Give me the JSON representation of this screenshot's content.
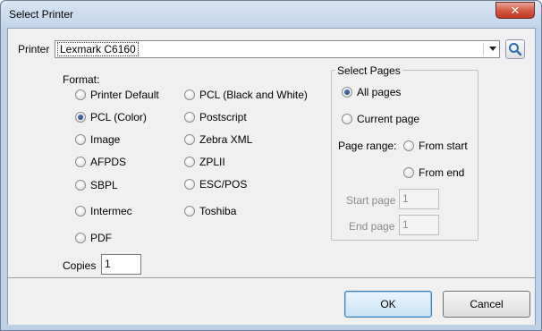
{
  "window": {
    "title": "Select Printer",
    "close_glyph": "✕"
  },
  "printer": {
    "label": "Printer",
    "selected": "Lexmark C6160",
    "search_icon": "search-icon"
  },
  "format": {
    "label": "Format:",
    "options": [
      {
        "label": "Printer Default",
        "checked": false
      },
      {
        "label": "PCL (Color)",
        "checked": true
      },
      {
        "label": "Image",
        "checked": false
      },
      {
        "label": "AFPDS",
        "checked": false
      },
      {
        "label": "SBPL",
        "checked": false
      },
      {
        "label": "Intermec",
        "checked": false
      },
      {
        "label": "PDF",
        "checked": false
      },
      {
        "label": "PCL (Black and White)",
        "checked": false
      },
      {
        "label": "Postscript",
        "checked": false
      },
      {
        "label": "Zebra XML",
        "checked": false
      },
      {
        "label": "ZPLII",
        "checked": false
      },
      {
        "label": "ESC/POS",
        "checked": false
      },
      {
        "label": "Toshiba",
        "checked": false
      }
    ]
  },
  "copies": {
    "label": "Copies",
    "value": "1"
  },
  "pages": {
    "legend": "Select Pages",
    "all_pages": "All pages",
    "current_page": "Current page",
    "range_label": "Page range:",
    "from_start": "From start",
    "from_end": "From end",
    "start_label": "Start page",
    "start_value": "1",
    "end_label": "End page",
    "end_value": "1"
  },
  "buttons": {
    "ok": "OK",
    "cancel": "Cancel"
  },
  "colors": {
    "title_bar": "#c9dbef",
    "close_button": "#c8432f",
    "accent": "#3c7fb1",
    "dialog_bg": "#f0f0f0"
  }
}
